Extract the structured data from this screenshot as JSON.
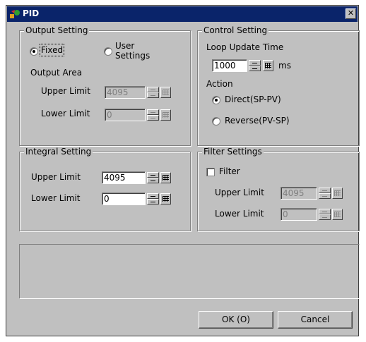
{
  "window": {
    "title": "PID",
    "close_glyph": "✕"
  },
  "output_setting": {
    "legend": "Output Setting",
    "fixed_label": "Fixed",
    "user_settings_label": "User Settings",
    "area_label": "Output Area",
    "upper_label": "Upper Limit",
    "upper_value": "4095",
    "lower_label": "Lower Limit",
    "lower_value": "0"
  },
  "control_setting": {
    "legend": "Control Setting",
    "loop_label": "Loop Update Time",
    "loop_value": "1000",
    "loop_unit": "ms",
    "action_label": "Action",
    "direct_label": "Direct(SP-PV)",
    "reverse_label": "Reverse(PV-SP)"
  },
  "integral_setting": {
    "legend": "Integral Setting",
    "upper_label": "Upper Limit",
    "upper_value": "4095",
    "lower_label": "Lower Limit",
    "lower_value": "0"
  },
  "filter_settings": {
    "legend": "Filter Settings",
    "filter_label": "Filter",
    "upper_label": "Upper Limit",
    "upper_value": "4095",
    "lower_label": "Lower Limit",
    "lower_value": "0"
  },
  "buttons": {
    "ok_label": "OK (O)",
    "cancel_label": "Cancel"
  }
}
